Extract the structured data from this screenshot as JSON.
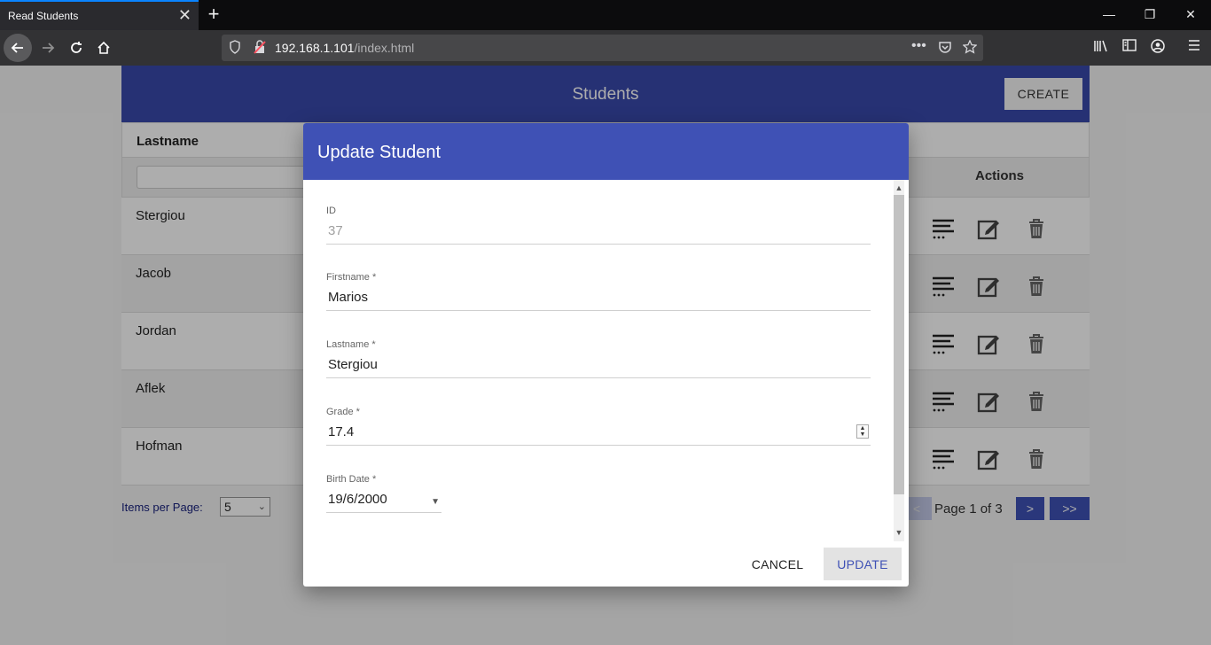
{
  "browser": {
    "tab_title": "Read Students",
    "tab_close": "✕",
    "new_tab": "+",
    "url_host": "192.168.1.101",
    "url_path": "/index.html",
    "window_controls": [
      "—",
      "❐",
      "✕"
    ]
  },
  "page": {
    "app_title": "Students",
    "create_label": "CREATE",
    "column_lastname": "Lastname",
    "column_actions": "Actions",
    "rows": [
      {
        "lastname": "Stergiou"
      },
      {
        "lastname": "Jacob"
      },
      {
        "lastname": "Jordan"
      },
      {
        "lastname": "Aflek"
      },
      {
        "lastname": "Hofman"
      }
    ],
    "items_per_page_label": "Items per Page:",
    "items_per_page_value": "5",
    "pager": {
      "prev": "<",
      "label": "Page 1 of 3",
      "next": ">",
      "last": ">>"
    }
  },
  "dialog": {
    "title": "Update Student",
    "fields": {
      "id": {
        "label": "ID",
        "value": "37"
      },
      "firstname": {
        "label": "Firstname *",
        "value": "Marios"
      },
      "lastname": {
        "label": "Lastname *",
        "value": "Stergiou"
      },
      "grade": {
        "label": "Grade *",
        "value": "17.4"
      },
      "birthdate": {
        "label": "Birth Date *",
        "value": "19/6/2000"
      }
    },
    "cancel_label": "CANCEL",
    "update_label": "UPDATE"
  },
  "colors": {
    "primary": "#3f51b5",
    "header": "#3949ab"
  }
}
